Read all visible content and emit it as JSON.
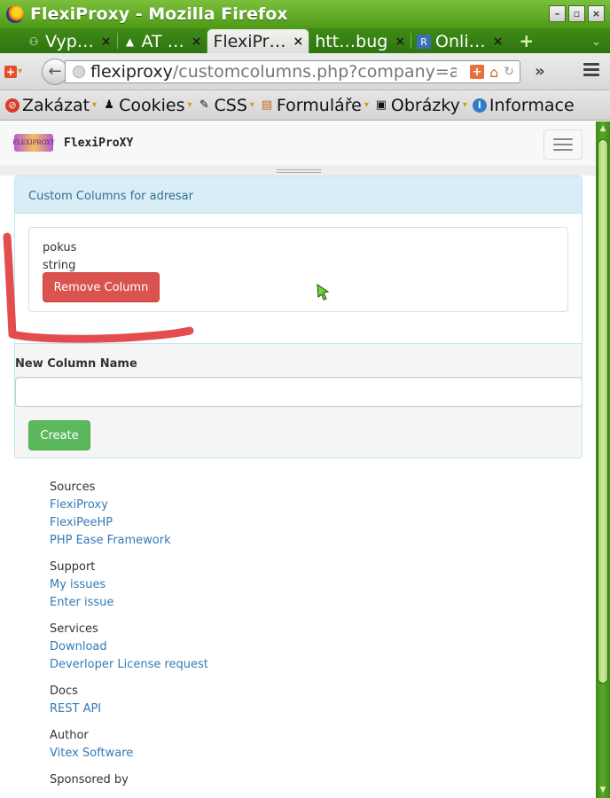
{
  "window": {
    "title": "FlexiProxy - Mozilla Firefox",
    "buttons": [
      "–",
      "▫",
      "×"
    ]
  },
  "tabs": [
    {
      "label": "Vyp…",
      "icon": "plug-icon",
      "active": false
    },
    {
      "label": "AT …",
      "icon": "mountain-icon",
      "active": false
    },
    {
      "label": "FlexiPr…",
      "icon": "none",
      "active": true
    },
    {
      "label": "htt…bug",
      "icon": "none",
      "active": false
    },
    {
      "label": "Onli…",
      "icon": "r-square-icon",
      "active": false
    }
  ],
  "tab_close": "×",
  "tab_new": "+",
  "tab_list": "⌄",
  "urlbar": {
    "domain": "flexiproxy",
    "path": "/customcolumns.php?company=a"
  },
  "bookmarks": [
    {
      "label": "Zakázat",
      "icon": "forbidden-icon"
    },
    {
      "label": "Cookies",
      "icon": "user-icon"
    },
    {
      "label": "CSS",
      "icon": "pencil-icon"
    },
    {
      "label": "Formuláře",
      "icon": "clipboard-icon"
    },
    {
      "label": "Obrázky",
      "icon": "picture-icon"
    },
    {
      "label": "Informace",
      "icon": "info-icon"
    }
  ],
  "site": {
    "logo_text": "FLEXIPROXY",
    "brand": "FlexiProXY"
  },
  "panel": {
    "heading": "Custom Columns for adresar",
    "column": {
      "name": "pokus",
      "type": "string"
    },
    "remove_label": "Remove Column",
    "new_column_label": "New Column Name",
    "new_column_value": "",
    "create_label": "Create"
  },
  "footer": [
    {
      "heading": "Sources",
      "links": [
        "FlexiProxy",
        "FlexiPeeHP",
        "PHP Ease Framework"
      ]
    },
    {
      "heading": "Support",
      "links": [
        "My issues",
        "Enter issue"
      ]
    },
    {
      "heading": "Services",
      "links": [
        "Download",
        "Deverloper License request"
      ]
    },
    {
      "heading": "Docs",
      "links": [
        "REST API"
      ]
    },
    {
      "heading": "Author",
      "links": [
        "Vitex Software"
      ]
    },
    {
      "heading": "Sponsored by",
      "links": []
    }
  ],
  "colors": {
    "firefox_green": "#4e9a17",
    "panel_info_bg": "#d9edf7",
    "danger": "#d9534f",
    "success": "#5cb85c",
    "link": "#337ab7",
    "annotation": "#e03a3a"
  }
}
